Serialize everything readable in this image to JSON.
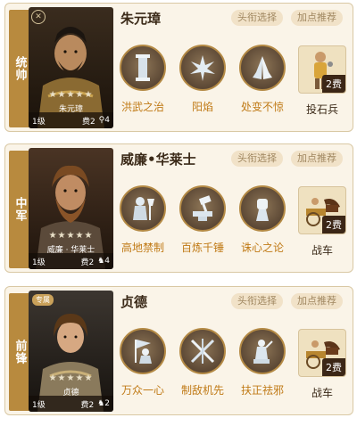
{
  "generals": [
    {
      "role": "统帅",
      "name": "朱元璋",
      "portrait_name": "朱元璋",
      "stars": "★★★★★",
      "level": "1级",
      "cost": "费2",
      "capacity": "4",
      "badge": "",
      "title_button": "头衔选择",
      "points_button": "加点推荐",
      "skills": [
        {
          "label": "洪武之治",
          "icon": "pillar-icon"
        },
        {
          "label": "阳焰",
          "icon": "sun-flame-icon"
        },
        {
          "label": "处变不惊",
          "icon": "praying-hands-icon"
        }
      ],
      "unit": {
        "label": "投石兵",
        "cost": "2费",
        "icon": "stone-thrower-icon"
      }
    },
    {
      "role": "中军",
      "name": "威廉•华莱士",
      "portrait_name": "威廉 · 华莱士",
      "stars": "★★★★★",
      "level": "1级",
      "cost": "费2",
      "capacity": "4",
      "badge": "",
      "title_button": "头衔选择",
      "points_button": "加点推荐",
      "skills": [
        {
          "label": "高地禁制",
          "icon": "warrior-axe-icon"
        },
        {
          "label": "百炼千锤",
          "icon": "anvil-hammer-icon"
        },
        {
          "label": "诛心之论",
          "icon": "raised-fist-icon"
        }
      ],
      "unit": {
        "label": "战车",
        "cost": "2费",
        "icon": "chariot-icon"
      }
    },
    {
      "role": "前锋",
      "name": "贞德",
      "portrait_name": "贞德",
      "stars": "★★★★★",
      "level": "1级",
      "cost": "费2",
      "capacity": "2",
      "badge": "专属",
      "title_button": "头衔选择",
      "points_button": "加点推荐",
      "skills": [
        {
          "label": "万众一心",
          "icon": "banner-bearer-icon"
        },
        {
          "label": "制敌机先",
          "icon": "crossed-swords-icon"
        },
        {
          "label": "扶正祛邪",
          "icon": "statue-icon"
        }
      ],
      "unit": {
        "label": "战车",
        "cost": "2费",
        "icon": "chariot-icon"
      }
    }
  ],
  "colors": {
    "accent": "#b88a3e",
    "skill_label": "#c07a16",
    "card_bg": "#faf4e8"
  }
}
